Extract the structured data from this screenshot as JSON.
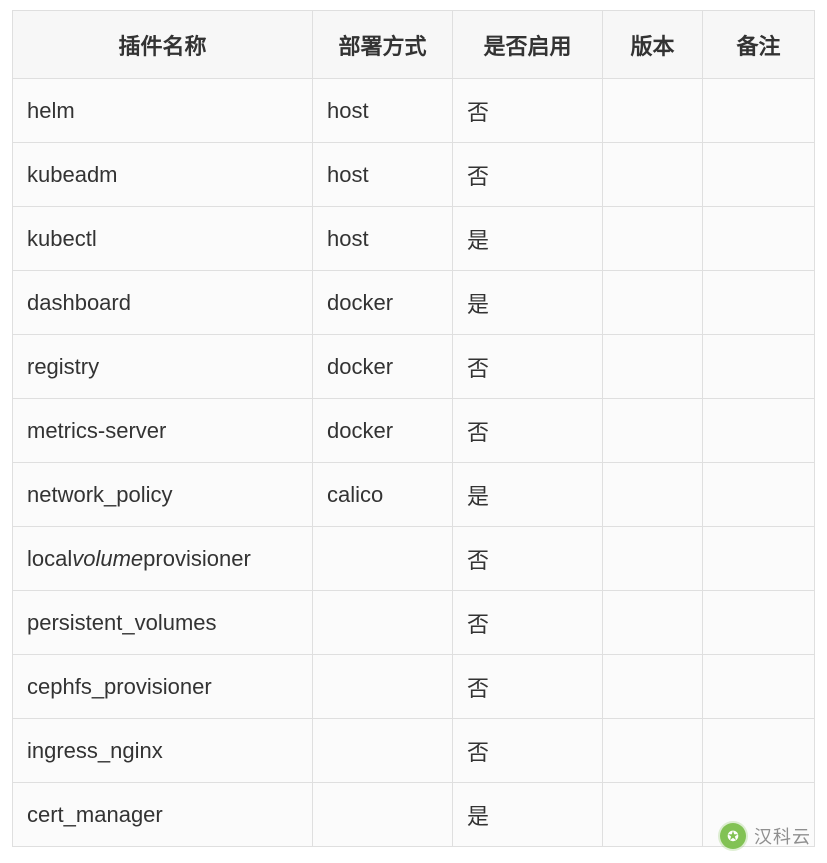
{
  "table": {
    "headers": {
      "name": "插件名称",
      "deploy": "部署方式",
      "enabled": "是否启用",
      "version": "版本",
      "notes": "备注"
    },
    "rows": [
      {
        "name": "helm",
        "deploy": "host",
        "enabled": "否",
        "version": "",
        "notes": ""
      },
      {
        "name": "kubeadm",
        "deploy": "host",
        "enabled": "否",
        "version": "",
        "notes": ""
      },
      {
        "name": "kubectl",
        "deploy": "host",
        "enabled": "是",
        "version": "",
        "notes": ""
      },
      {
        "name": "dashboard",
        "deploy": "docker",
        "enabled": "是",
        "version": "",
        "notes": ""
      },
      {
        "name": "registry",
        "deploy": "docker",
        "enabled": "否",
        "version": "",
        "notes": ""
      },
      {
        "name": "metrics-server",
        "deploy": "docker",
        "enabled": "否",
        "version": "",
        "notes": ""
      },
      {
        "name": "network_policy",
        "deploy": "calico",
        "enabled": "是",
        "version": "",
        "notes": ""
      },
      {
        "name": "local_volume_provisioner",
        "deploy": "",
        "enabled": "否",
        "version": "",
        "notes": "",
        "name_italic_mid": true,
        "name_pre": "local",
        "name_mid": "volume",
        "name_post": "provisioner"
      },
      {
        "name": "persistent_volumes",
        "deploy": "",
        "enabled": "否",
        "version": "",
        "notes": ""
      },
      {
        "name": "cephfs_provisioner",
        "deploy": "",
        "enabled": "否",
        "version": "",
        "notes": ""
      },
      {
        "name": "ingress_nginx",
        "deploy": "",
        "enabled": "否",
        "version": "",
        "notes": ""
      },
      {
        "name": "cert_manager",
        "deploy": "",
        "enabled": "是",
        "version": "",
        "notes": ""
      }
    ]
  },
  "watermark": {
    "label": "汉科云",
    "icon_glyph": "✪"
  },
  "chart_data": {
    "type": "table",
    "title": "",
    "columns": [
      "插件名称",
      "部署方式",
      "是否启用",
      "版本",
      "备注"
    ],
    "rows": [
      [
        "helm",
        "host",
        "否",
        "",
        ""
      ],
      [
        "kubeadm",
        "host",
        "否",
        "",
        ""
      ],
      [
        "kubectl",
        "host",
        "是",
        "",
        ""
      ],
      [
        "dashboard",
        "docker",
        "是",
        "",
        ""
      ],
      [
        "registry",
        "docker",
        "否",
        "",
        ""
      ],
      [
        "metrics-server",
        "docker",
        "否",
        "",
        ""
      ],
      [
        "network_policy",
        "calico",
        "是",
        "",
        ""
      ],
      [
        "local_volume_provisioner",
        "",
        "否",
        "",
        ""
      ],
      [
        "persistent_volumes",
        "",
        "否",
        "",
        ""
      ],
      [
        "cephfs_provisioner",
        "",
        "否",
        "",
        ""
      ],
      [
        "ingress_nginx",
        "",
        "否",
        "",
        ""
      ],
      [
        "cert_manager",
        "",
        "是",
        "",
        ""
      ]
    ]
  }
}
